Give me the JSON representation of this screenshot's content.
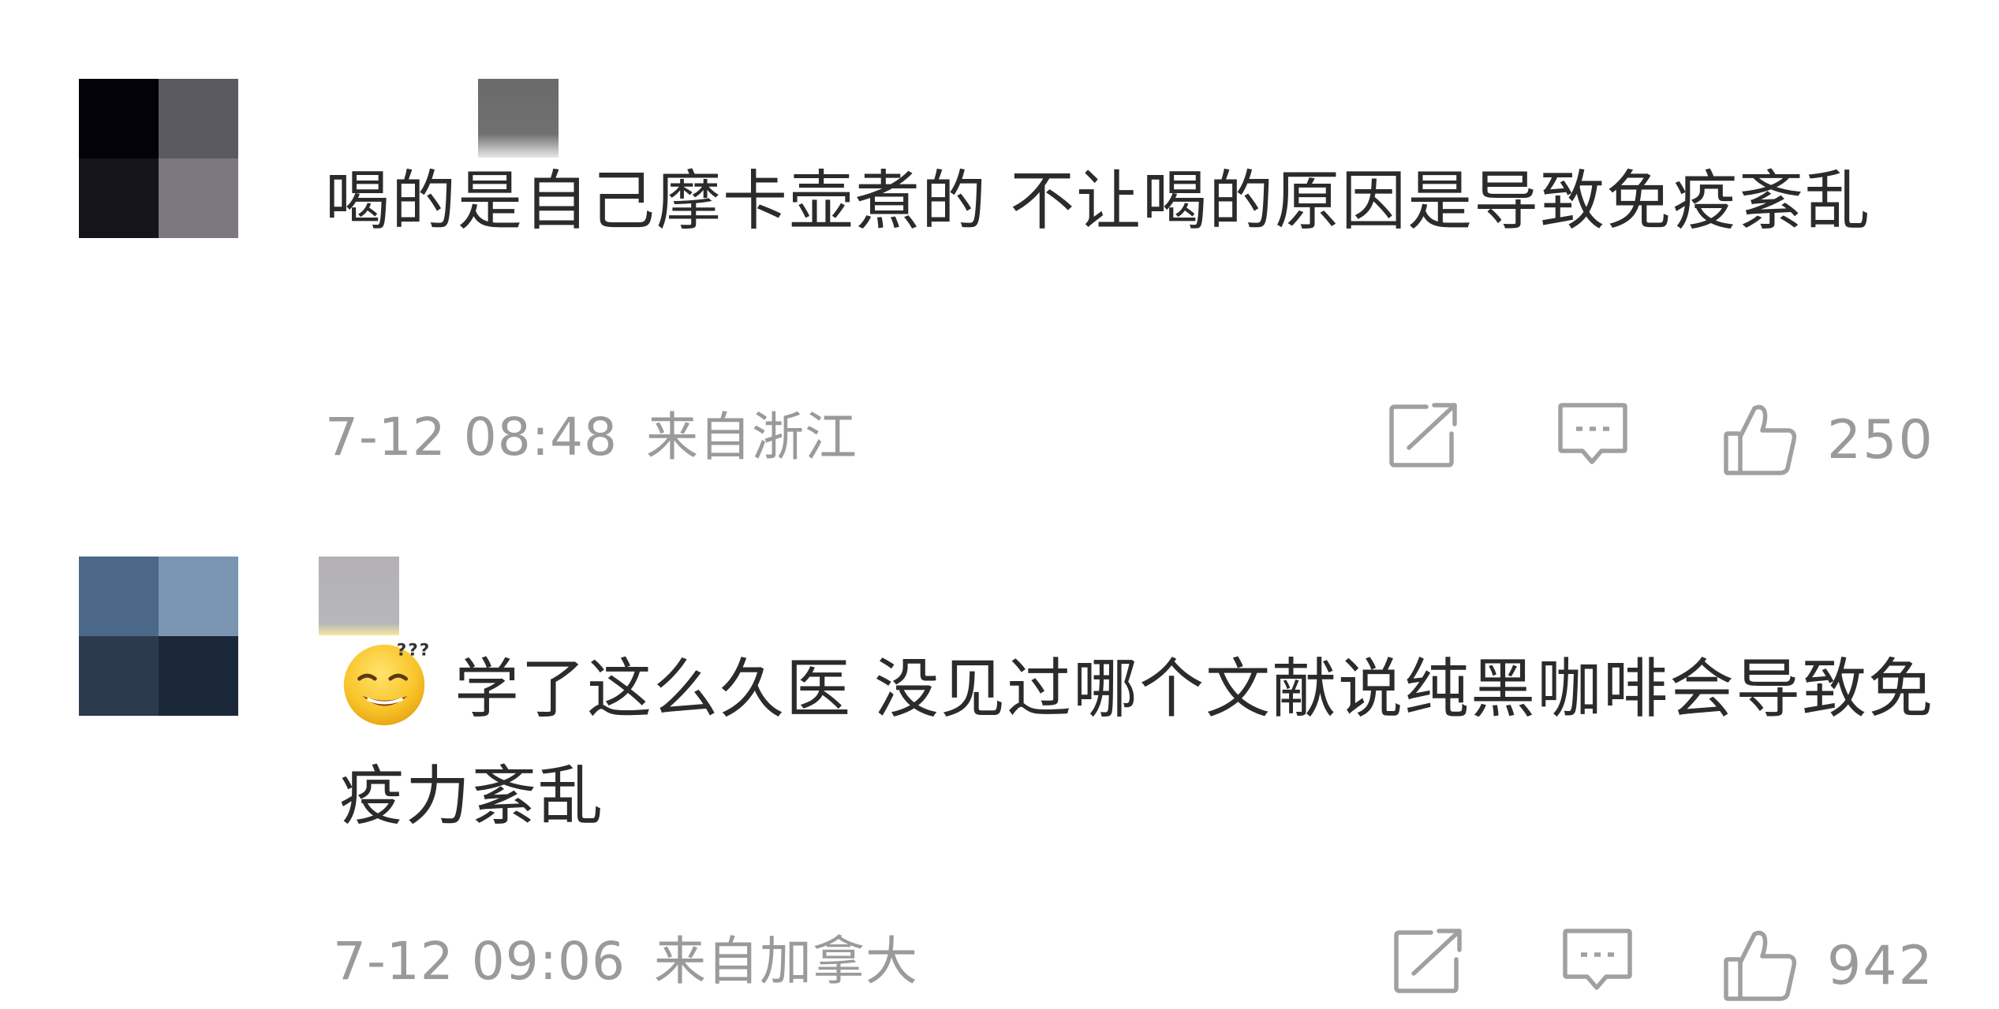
{
  "colors": {
    "text": "#2b2b2b",
    "meta": "#9a9a9a",
    "icon": "#a0a0a0",
    "background": "#ffffff"
  },
  "comments": [
    {
      "avatar_colors": [
        "#030208",
        "#5c5a61",
        "#16141b",
        "#7b797f"
      ],
      "text": "喝的是自己摩卡壶煮的 不让喝的原因是导致免疫紊乱",
      "time": "7-12 08:48",
      "location": "来自浙江",
      "likes": "250",
      "icons": {
        "share": "share-icon",
        "reply": "comment-icon",
        "like": "thumbs-up-icon"
      }
    },
    {
      "avatar_colors": [
        "#4b6889",
        "#7995b1",
        "#2b3a4d",
        "#1b283a"
      ],
      "emoji": "dizzy-sweat-smile-emoji",
      "text": "学了这么久医 没见过哪个文献说纯黑咖啡会导致免疫力紊乱",
      "time": "7-12 09:06",
      "location": "来自加拿大",
      "likes": "942",
      "icons": {
        "share": "share-icon",
        "reply": "comment-icon",
        "like": "thumbs-up-icon"
      }
    }
  ]
}
